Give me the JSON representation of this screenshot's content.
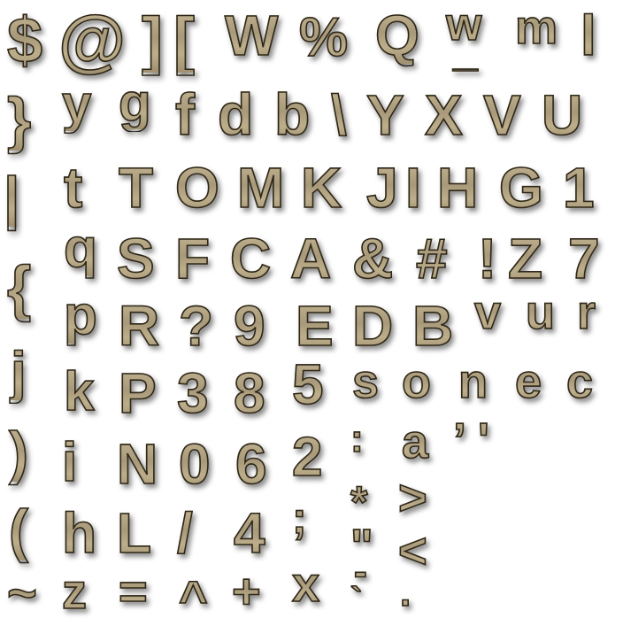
{
  "atlas": {
    "glyphs": [
      "$",
      "@",
      "]",
      "[",
      "W",
      "%",
      "Q",
      "w",
      "m",
      "l",
      "}",
      "y",
      "g",
      "f",
      "d",
      "b",
      "\\",
      "Y",
      "X",
      "V",
      "U",
      "|",
      "t",
      "T",
      "O",
      "M",
      "K",
      "J",
      "I",
      "H",
      "G",
      "1",
      "{",
      "q",
      "S",
      "F",
      "C",
      "A",
      "&",
      "#",
      "!",
      "Z",
      "7",
      "p",
      "R",
      "?",
      "9",
      "E",
      "D",
      "B",
      "v",
      "u",
      "r",
      "j",
      "k",
      "P",
      "3",
      "8",
      "5",
      "s",
      "o",
      "n",
      "e",
      "c",
      ")",
      "i",
      "N",
      "0",
      "6",
      "2",
      ":",
      "a",
      "’",
      "'",
      "(",
      "h",
      "L",
      "/",
      "4",
      ";",
      "*",
      ">",
      "~",
      "z",
      "=",
      "^",
      "+",
      "x",
      "\"",
      "<",
      "-",
      "_",
      "`",
      "."
    ],
    "glyph_color": "#b3a582",
    "outline_color": "#2e2718",
    "background_color": "#ffffff"
  }
}
